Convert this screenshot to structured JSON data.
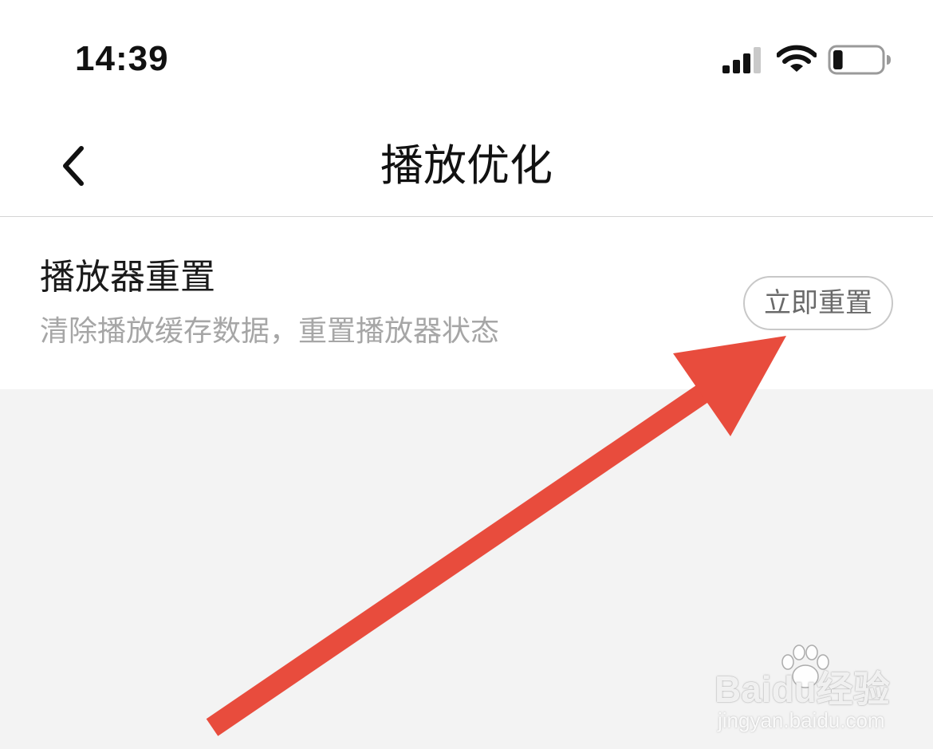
{
  "status_bar": {
    "time": "14:39",
    "signal_icon": "cellular-signal-icon",
    "wifi_icon": "wifi-icon",
    "battery_icon": "battery-low-icon",
    "battery_level": 0.2
  },
  "nav": {
    "back_icon": "chevron-left-icon",
    "title": "播放优化"
  },
  "setting": {
    "title": "播放器重置",
    "description": "清除播放缓存数据，重置播放器状态",
    "button_label": "立即重置"
  },
  "annotation": {
    "arrow_color": "#e84c3d"
  },
  "watermark": {
    "brand": "Baidu经验",
    "url": "jingyan.baidu.com"
  },
  "colors": {
    "background": "#f3f3f3",
    "panel": "#ffffff",
    "title_text": "#111111",
    "secondary_text": "#a6a6a6",
    "button_border": "#c8c8c8"
  }
}
